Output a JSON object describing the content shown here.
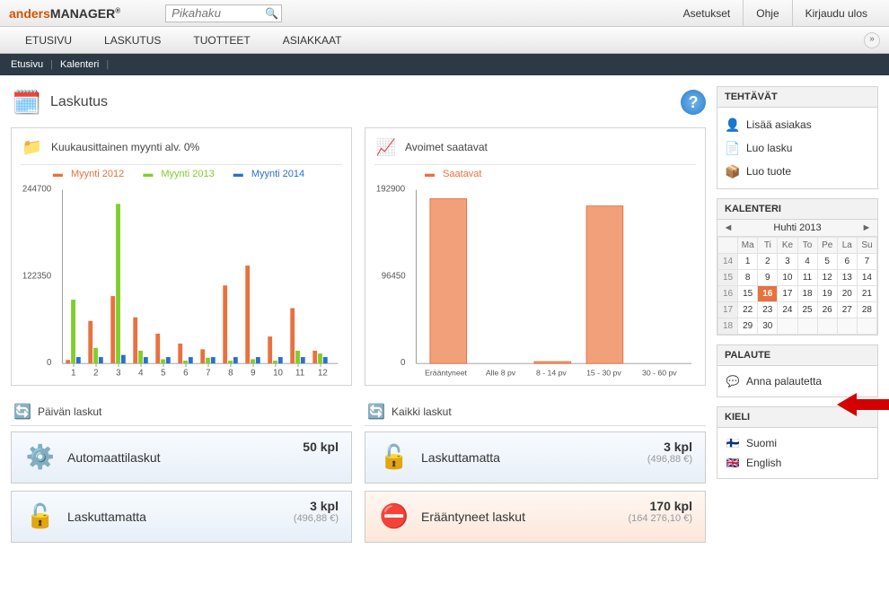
{
  "logo": {
    "part1": "anders",
    "part2": "MANAGER"
  },
  "search": {
    "placeholder": "Pikahaku"
  },
  "top_links": {
    "settings": "Asetukset",
    "help": "Ohje",
    "logout": "Kirjaudu ulos"
  },
  "nav": {
    "etusivu": "ETUSIVU",
    "laskutus": "LASKUTUS",
    "tuotteet": "TUOTTEET",
    "asiakkaat": "ASIAKKAAT"
  },
  "subnav": {
    "etusivu": "Etusivu",
    "kalenteri": "Kalenteri"
  },
  "page_title": "Laskutus",
  "chart1": {
    "title": "Kuukausittainen myynti alv. 0%",
    "legend": {
      "s1": "Myynti 2012",
      "s2": "Myynti 2013",
      "s3": "Myynti 2014"
    },
    "y_max": "244700",
    "y_mid": "122350",
    "y_min": "0"
  },
  "chart2": {
    "title": "Avoimet saatavat",
    "legend": "Saatavat",
    "y_max": "192900",
    "y_mid": "96450",
    "y_min": "0",
    "xlabels": {
      "x1": "Erääntyneet",
      "x2": "Alle 8 pv",
      "x3": "8 - 14 pv",
      "x4": "15 - 30 pv",
      "x5": "30 - 60 pv"
    }
  },
  "inv_left": {
    "title": "Päivän laskut",
    "card1": {
      "label": "Automaattilaskut",
      "count": "50 kpl"
    },
    "card2": {
      "label": "Laskuttamatta",
      "count": "3 kpl",
      "sub": "(496,88 €)"
    }
  },
  "inv_right": {
    "title": "Kaikki laskut",
    "card1": {
      "label": "Laskuttamatta",
      "count": "3 kpl",
      "sub": "(496,88 €)"
    },
    "card2": {
      "label": "Erääntyneet laskut",
      "count": "170 kpl",
      "sub": "(164 276,10 €)"
    }
  },
  "side": {
    "tasks_title": "TEHTÄVÄT",
    "task1": "Lisää asiakas",
    "task2": "Luo lasku",
    "task3": "Luo tuote",
    "cal_title": "KALENTERI",
    "cal_month": "Huhti 2013",
    "dow": {
      "d1": "Ma",
      "d2": "Ti",
      "d3": "Ke",
      "d4": "To",
      "d5": "Pe",
      "d6": "La",
      "d7": "Su"
    },
    "feedback_title": "PALAUTE",
    "feedback_link": "Anna palautetta",
    "lang_title": "KIELI",
    "lang1": "Suomi",
    "lang2": "English"
  },
  "chart_data": [
    {
      "type": "bar",
      "title": "Kuukausittainen myynti alv. 0%",
      "xlabel": "",
      "ylabel": "",
      "ylim": [
        0,
        244700
      ],
      "categories": [
        "1",
        "2",
        "3",
        "4",
        "5",
        "6",
        "7",
        "8",
        "9",
        "10",
        "11",
        "12"
      ],
      "series": [
        {
          "name": "Myynti 2012",
          "color": "#e8713f",
          "values": [
            5000,
            60000,
            95000,
            65000,
            42000,
            28000,
            20000,
            110000,
            138000,
            38000,
            78000,
            18000
          ]
        },
        {
          "name": "Myynti 2013",
          "color": "#7fcf2b",
          "values": [
            90000,
            22000,
            225000,
            18000,
            6000,
            4000,
            8000,
            4000,
            6000,
            4000,
            18000,
            14000
          ]
        },
        {
          "name": "Myynti 2014",
          "color": "#2b6fcf",
          "values": [
            9000,
            9000,
            12000,
            9000,
            9000,
            9000,
            9000,
            9000,
            9000,
            9000,
            9000,
            9000
          ]
        }
      ]
    },
    {
      "type": "bar",
      "title": "Avoimet saatavat",
      "xlabel": "",
      "ylabel": "",
      "ylim": [
        0,
        192900
      ],
      "categories": [
        "Erääntyneet",
        "Alle 8 pv",
        "8 - 14 pv",
        "15 - 30 pv",
        "30 - 60 pv"
      ],
      "series": [
        {
          "name": "Saatavat",
          "color": "#f2a07a",
          "values": [
            183000,
            0,
            2000,
            175000,
            0
          ]
        }
      ]
    }
  ]
}
